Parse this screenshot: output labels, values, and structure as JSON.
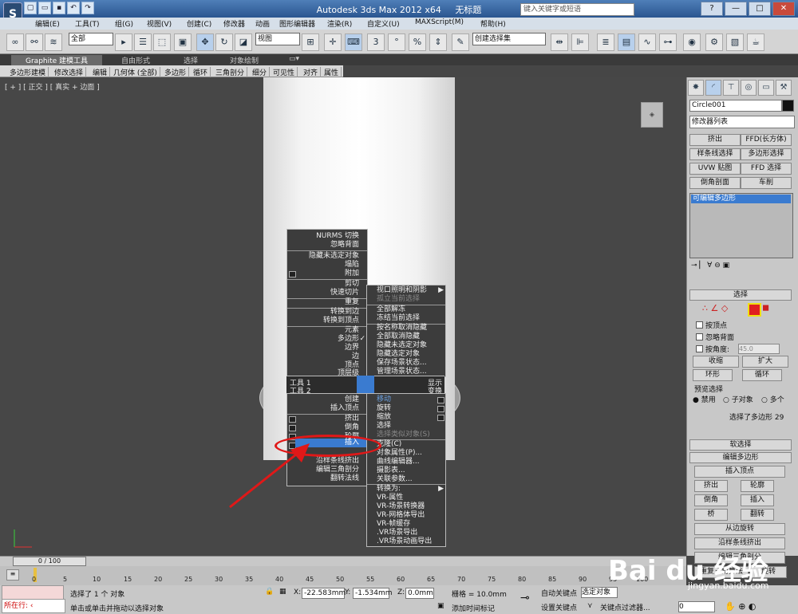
{
  "titlebar": {
    "app_title": "Autodesk 3ds Max  2012 x64",
    "doc_title": "无标题",
    "search_placeholder": "键入关键字或短语",
    "logo": "S",
    "win_min": "—",
    "win_max": "□",
    "win_close": "✕",
    "help_btn": "?"
  },
  "menubar": {
    "items": [
      "编辑(E)",
      "工具(T)",
      "组(G)",
      "视图(V)",
      "创建(C)",
      "修改器",
      "动画",
      "图形编辑器",
      "渲染(R)",
      "自定义(U)",
      "MAXScript(M)",
      "帮助(H)"
    ]
  },
  "toolbar": {
    "filter_value": "全部",
    "ref_coord_value": "视图",
    "named_sel_value": "创建选择集",
    "snap3": "3",
    "snap_percent": "%",
    "snap_angle": "°"
  },
  "ribbon": {
    "tabs": [
      "Graphite 建模工具",
      "自由形式",
      "选择",
      "对象绘制"
    ],
    "subtabs": [
      "多边形建模",
      "修改选择",
      "编辑",
      "几何体 (全部)",
      "多边形",
      "循环",
      "三角剖分",
      "细分",
      "可见性",
      "对齐",
      "属性"
    ]
  },
  "viewport": {
    "label": "[ + ] [ 正交 ] [ 真实 + 边面 ]"
  },
  "quad_left": {
    "items": [
      "NURMS 切换",
      "忽略背面",
      "隐藏未选定对象",
      "塌陷",
      "附加",
      "剪切",
      "快速切片",
      "重复",
      "转换到边",
      "转换到顶点",
      "元素",
      "多边形",
      "边界",
      "边",
      "顶点",
      "顶层级"
    ],
    "tools1": "工具 1",
    "tools2": "工具 2",
    "items2": [
      "创建",
      "插入顶点",
      "挤出",
      "倒角",
      "轮廓",
      "插入",
      "沿样条线挤出",
      "编辑三角剖分",
      "翻转法线"
    ]
  },
  "quad_right": {
    "items": [
      "视口照明和阴影",
      "孤立当前选择",
      "全部解冻",
      "冻结当前选择",
      "按名称取消隐藏",
      "全部取消隐藏",
      "隐藏未选定对象",
      "隐藏选定对象",
      "保存场景状态...",
      "管理场景状态..."
    ],
    "display": "显示",
    "transform": "变换",
    "items2": [
      "移动",
      "旋转",
      "缩放",
      "选择",
      "选择类似对象(S)",
      "克隆(C)",
      "对象属性(P)...",
      "曲线编辑器...",
      "摄影表...",
      "关联参数...",
      "转换为:",
      "VR-属性",
      "VR-场景转换器",
      "VR-网格体导出",
      "VR-帧缓存",
      ".VR场景导出",
      ".VR场景动画导出"
    ]
  },
  "cmdpanel": {
    "object_name": "Circle001",
    "modifier_list": "修改器列表",
    "mod_buttons": [
      "挤出",
      "FFD(长方体)",
      "样条线选择",
      "多边形选择",
      "UVW 贴图",
      "FFD 选择",
      "倒角剖面",
      "车削"
    ],
    "stack_item": "可编辑多边形",
    "rollout_select": "选择",
    "by_vertex": "按顶点",
    "ignore_backface": "忽略背面",
    "by_angle": "按角度:",
    "angle_value": "45.0",
    "shrink": "收缩",
    "grow": "扩大",
    "ring": "环形",
    "loop": "循环",
    "preview_select": "预览选择",
    "disabled": "禁用",
    "subobj": "子对象",
    "multi": "多个",
    "sel_status": "选择了多边形 29",
    "soft_select": "软选择",
    "edit_poly": "编辑多边形",
    "insert_vertex": "插入顶点",
    "extrude": "挤出",
    "outline": "轮廓",
    "bevel": "倒角",
    "inset": "插入",
    "bridge": "桥",
    "flip": "翻转",
    "hinge": "从边旋转",
    "extrude_spline": "沿样条线挤出",
    "edit_tri": "编辑三角剖分",
    "retri": "重复三角算法",
    "turn": "旋转"
  },
  "bottom": {
    "time_slider": "0 / 100",
    "ticks": [
      "0",
      "5",
      "10",
      "15",
      "20",
      "25",
      "30",
      "35",
      "40",
      "45",
      "50",
      "55",
      "60",
      "65",
      "70",
      "75",
      "80",
      "85",
      "90",
      "95",
      "100"
    ],
    "status1": "选择了 1 个 对象",
    "status2": "单击或单击并拖动以选择对象",
    "running": "所在行:",
    "x_label": "X:",
    "x_value": "-22.583mm",
    "y_label": "Y:",
    "y_value": "-1.534mm",
    "z_label": "Z:",
    "z_value": "0.0mm",
    "grid": "栅格 = 10.0mm",
    "add_time_tag": "添加时间标记",
    "auto_key": "自动关键点",
    "selected": "选定对象",
    "set_key": "设置关键点",
    "key_filter": "关键点过滤器...",
    "frame": "0"
  },
  "watermark": {
    "brand": "Bai du 经验",
    "url": "jingyan.baidu.com"
  }
}
